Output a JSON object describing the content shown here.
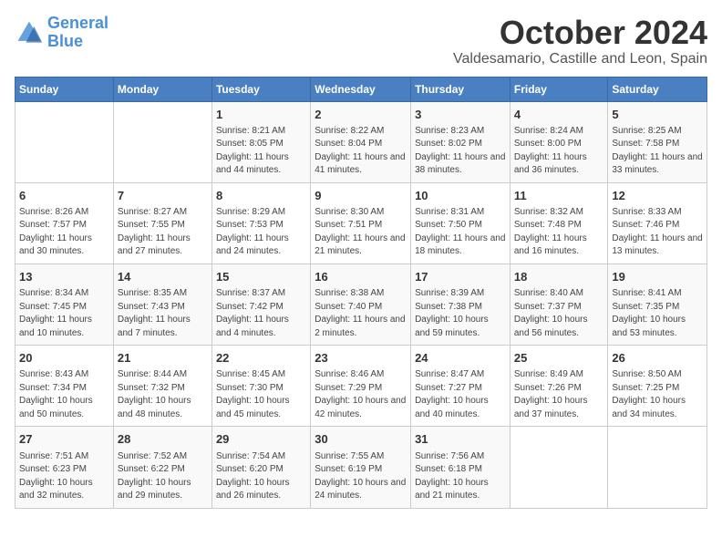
{
  "header": {
    "logo_line1": "General",
    "logo_line2": "Blue",
    "month_year": "October 2024",
    "location": "Valdesamario, Castille and Leon, Spain"
  },
  "weekdays": [
    "Sunday",
    "Monday",
    "Tuesday",
    "Wednesday",
    "Thursday",
    "Friday",
    "Saturday"
  ],
  "weeks": [
    [
      {
        "day": "",
        "info": ""
      },
      {
        "day": "",
        "info": ""
      },
      {
        "day": "1",
        "info": "Sunrise: 8:21 AM\nSunset: 8:05 PM\nDaylight: 11 hours and 44 minutes."
      },
      {
        "day": "2",
        "info": "Sunrise: 8:22 AM\nSunset: 8:04 PM\nDaylight: 11 hours and 41 minutes."
      },
      {
        "day": "3",
        "info": "Sunrise: 8:23 AM\nSunset: 8:02 PM\nDaylight: 11 hours and 38 minutes."
      },
      {
        "day": "4",
        "info": "Sunrise: 8:24 AM\nSunset: 8:00 PM\nDaylight: 11 hours and 36 minutes."
      },
      {
        "day": "5",
        "info": "Sunrise: 8:25 AM\nSunset: 7:58 PM\nDaylight: 11 hours and 33 minutes."
      }
    ],
    [
      {
        "day": "6",
        "info": "Sunrise: 8:26 AM\nSunset: 7:57 PM\nDaylight: 11 hours and 30 minutes."
      },
      {
        "day": "7",
        "info": "Sunrise: 8:27 AM\nSunset: 7:55 PM\nDaylight: 11 hours and 27 minutes."
      },
      {
        "day": "8",
        "info": "Sunrise: 8:29 AM\nSunset: 7:53 PM\nDaylight: 11 hours and 24 minutes."
      },
      {
        "day": "9",
        "info": "Sunrise: 8:30 AM\nSunset: 7:51 PM\nDaylight: 11 hours and 21 minutes."
      },
      {
        "day": "10",
        "info": "Sunrise: 8:31 AM\nSunset: 7:50 PM\nDaylight: 11 hours and 18 minutes."
      },
      {
        "day": "11",
        "info": "Sunrise: 8:32 AM\nSunset: 7:48 PM\nDaylight: 11 hours and 16 minutes."
      },
      {
        "day": "12",
        "info": "Sunrise: 8:33 AM\nSunset: 7:46 PM\nDaylight: 11 hours and 13 minutes."
      }
    ],
    [
      {
        "day": "13",
        "info": "Sunrise: 8:34 AM\nSunset: 7:45 PM\nDaylight: 11 hours and 10 minutes."
      },
      {
        "day": "14",
        "info": "Sunrise: 8:35 AM\nSunset: 7:43 PM\nDaylight: 11 hours and 7 minutes."
      },
      {
        "day": "15",
        "info": "Sunrise: 8:37 AM\nSunset: 7:42 PM\nDaylight: 11 hours and 4 minutes."
      },
      {
        "day": "16",
        "info": "Sunrise: 8:38 AM\nSunset: 7:40 PM\nDaylight: 11 hours and 2 minutes."
      },
      {
        "day": "17",
        "info": "Sunrise: 8:39 AM\nSunset: 7:38 PM\nDaylight: 10 hours and 59 minutes."
      },
      {
        "day": "18",
        "info": "Sunrise: 8:40 AM\nSunset: 7:37 PM\nDaylight: 10 hours and 56 minutes."
      },
      {
        "day": "19",
        "info": "Sunrise: 8:41 AM\nSunset: 7:35 PM\nDaylight: 10 hours and 53 minutes."
      }
    ],
    [
      {
        "day": "20",
        "info": "Sunrise: 8:43 AM\nSunset: 7:34 PM\nDaylight: 10 hours and 50 minutes."
      },
      {
        "day": "21",
        "info": "Sunrise: 8:44 AM\nSunset: 7:32 PM\nDaylight: 10 hours and 48 minutes."
      },
      {
        "day": "22",
        "info": "Sunrise: 8:45 AM\nSunset: 7:30 PM\nDaylight: 10 hours and 45 minutes."
      },
      {
        "day": "23",
        "info": "Sunrise: 8:46 AM\nSunset: 7:29 PM\nDaylight: 10 hours and 42 minutes."
      },
      {
        "day": "24",
        "info": "Sunrise: 8:47 AM\nSunset: 7:27 PM\nDaylight: 10 hours and 40 minutes."
      },
      {
        "day": "25",
        "info": "Sunrise: 8:49 AM\nSunset: 7:26 PM\nDaylight: 10 hours and 37 minutes."
      },
      {
        "day": "26",
        "info": "Sunrise: 8:50 AM\nSunset: 7:25 PM\nDaylight: 10 hours and 34 minutes."
      }
    ],
    [
      {
        "day": "27",
        "info": "Sunrise: 7:51 AM\nSunset: 6:23 PM\nDaylight: 10 hours and 32 minutes."
      },
      {
        "day": "28",
        "info": "Sunrise: 7:52 AM\nSunset: 6:22 PM\nDaylight: 10 hours and 29 minutes."
      },
      {
        "day": "29",
        "info": "Sunrise: 7:54 AM\nSunset: 6:20 PM\nDaylight: 10 hours and 26 minutes."
      },
      {
        "day": "30",
        "info": "Sunrise: 7:55 AM\nSunset: 6:19 PM\nDaylight: 10 hours and 24 minutes."
      },
      {
        "day": "31",
        "info": "Sunrise: 7:56 AM\nSunset: 6:18 PM\nDaylight: 10 hours and 21 minutes."
      },
      {
        "day": "",
        "info": ""
      },
      {
        "day": "",
        "info": ""
      }
    ]
  ]
}
